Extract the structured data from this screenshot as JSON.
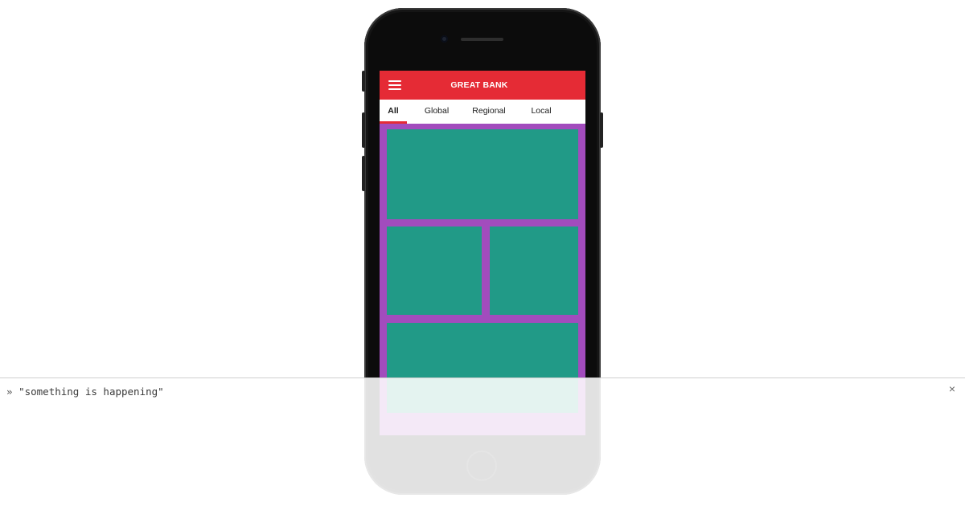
{
  "app": {
    "title": "GREAT BANK",
    "colors": {
      "appbar": "#e52b35",
      "screen_background": "#a24cbd",
      "card": "#219a87",
      "tab_indicator": "#e52b35"
    },
    "menu_icon": "hamburger-menu-icon",
    "tabs": [
      {
        "label": "All",
        "active": true
      },
      {
        "label": "Global",
        "active": false
      },
      {
        "label": "Regional",
        "active": false
      },
      {
        "label": "Local",
        "active": false
      }
    ],
    "cards": [
      "hero",
      "left",
      "right",
      "bottom"
    ]
  },
  "console": {
    "prompt": "»",
    "message": "\"something is happening\"",
    "close_icon": "close-icon",
    "close_glyph": "×"
  }
}
